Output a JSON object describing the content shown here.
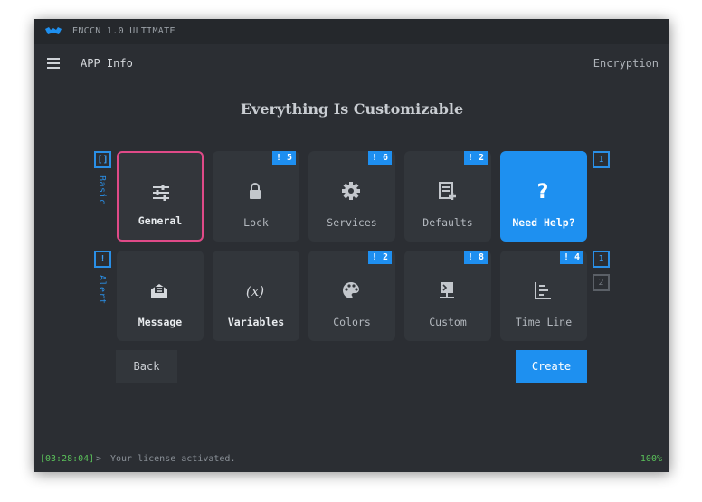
{
  "window": {
    "title": "ENCCN 1.0 ULTIMATE"
  },
  "appbar": {
    "title": "APP Info",
    "right_link": "Encryption"
  },
  "heading": "Everything Is Customizable",
  "sections": [
    {
      "box": "[]",
      "label": "Basic"
    },
    {
      "box": "!",
      "label": "Alert"
    }
  ],
  "pages": {
    "row1": "1",
    "row2_current": "1",
    "row2_next": "2"
  },
  "tiles_row1": [
    {
      "label": "General",
      "badge": "",
      "icon": "sliders-icon"
    },
    {
      "label": "Lock",
      "badge": "! 5",
      "icon": "lock-icon"
    },
    {
      "label": "Services",
      "badge": "! 6",
      "icon": "gear-icon"
    },
    {
      "label": "Defaults",
      "badge": "! 2",
      "icon": "document-add-icon"
    },
    {
      "label": "Need Help?",
      "badge": "",
      "icon": "question-icon"
    }
  ],
  "tiles_row2": [
    {
      "label": "Message",
      "badge": "",
      "icon": "mail-open-icon"
    },
    {
      "label": "Variables",
      "badge": "",
      "icon": "variable-icon"
    },
    {
      "label": "Colors",
      "badge": "! 2",
      "icon": "palette-icon"
    },
    {
      "label": "Custom",
      "badge": "! 8",
      "icon": "terminal-network-icon"
    },
    {
      "label": "Time Line",
      "badge": "! 4",
      "icon": "timeline-icon"
    }
  ],
  "buttons": {
    "back": "Back",
    "create": "Create"
  },
  "status": {
    "time": "[03:28:04]",
    "prompt": ">",
    "message": "Your license activated.",
    "progress": "100%"
  },
  "colors": {
    "accent": "#1e90f0",
    "active_border": "#e04a88",
    "success": "#5ac05a",
    "background": "#2b2e33"
  }
}
